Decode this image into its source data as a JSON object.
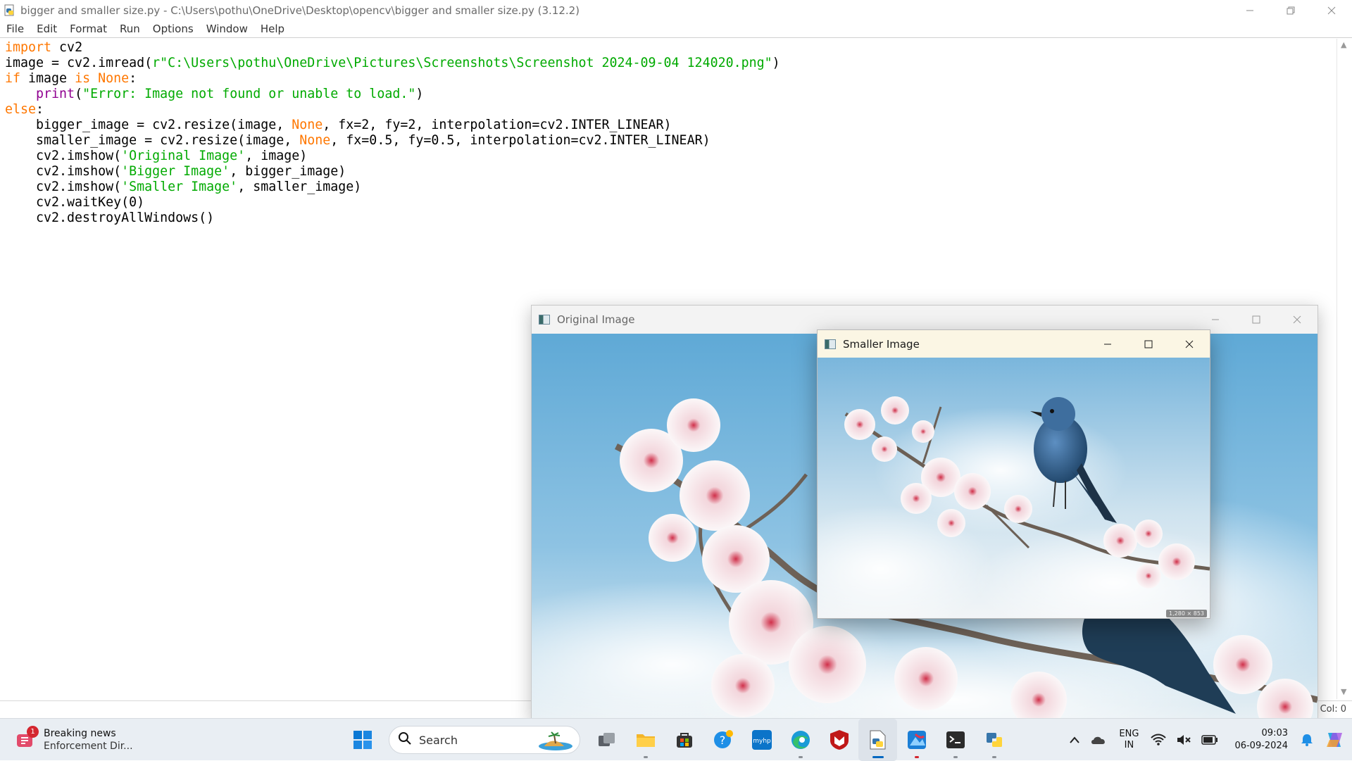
{
  "window": {
    "title": "bigger and smaller size.py - C:\\Users\\pothu\\OneDrive\\Desktop\\opencv\\bigger and smaller size.py (3.12.2)",
    "minimize_icon": "minimize-icon",
    "restore_icon": "restore-icon",
    "close_icon": "close-icon"
  },
  "menu": [
    "File",
    "Edit",
    "Format",
    "Run",
    "Options",
    "Window",
    "Help"
  ],
  "code": {
    "l1_kw": "import",
    "l1_rest": " cv2",
    "l2_a": "image = cv2.imread(",
    "l2_str": "r\"C:\\Users\\pothu\\OneDrive\\Pictures\\Screenshots\\Screenshot 2024-09-04 124020.png\"",
    "l2_b": ")",
    "l3_kw1": "if",
    "l3_a": " image ",
    "l3_kw2": "is",
    "l3_b": " ",
    "l3_kw3": "None",
    "l3_c": ":",
    "l4_indent": "    ",
    "l4_bi": "print",
    "l4_a": "(",
    "l4_str": "\"Error: Image not found or unable to load.\"",
    "l4_b": ")",
    "l5_kw": "else",
    "l5_rest": ":",
    "l6_a": "    bigger_image = cv2.resize(image, ",
    "l6_kw": "None",
    "l6_b": ", fx=2, fy=2, interpolation=cv2.INTER_LINEAR)",
    "l7_a": "    smaller_image = cv2.resize(image, ",
    "l7_kw": "None",
    "l7_b": ", fx=0.5, fy=0.5, interpolation=cv2.INTER_LINEAR)",
    "l8_a": "    cv2.imshow(",
    "l8_str": "'Original Image'",
    "l8_b": ", image)",
    "l9_a": "    cv2.imshow(",
    "l9_str": "'Bigger Image'",
    "l9_b": ", bigger_image)",
    "l10_a": "    cv2.imshow(",
    "l10_str": "'Smaller Image'",
    "l10_b": ", smaller_image)",
    "l11": "    cv2.waitKey(0)",
    "l12": "    cv2.destroyAllWindows()"
  },
  "status": {
    "col": "Col: 0"
  },
  "original_window": {
    "title": "Original Image"
  },
  "smaller_window": {
    "title": "Smaller Image",
    "size_badge": "1,280 × 853"
  },
  "taskbar": {
    "news": {
      "badge": "1",
      "line1": "Breaking news",
      "line2": "Enforcement Dir..."
    },
    "search_label": "Search",
    "apps": [
      "start-icon",
      "search",
      "task-view-icon",
      "file-explorer-icon",
      "microsoft-store-icon",
      "help-icon",
      "myhp-icon",
      "edge-icon",
      "mcafee-icon",
      "idle-editor-icon",
      "photos-icon",
      "terminal-icon",
      "python-icon"
    ],
    "myhp_label": "myhp",
    "tray": {
      "lang1": "ENG",
      "lang2": "IN",
      "time": "09:03",
      "date": "06-09-2024"
    }
  },
  "colors": {
    "keyword": "#ff7700",
    "string": "#00aa00",
    "builtin": "#900090",
    "accent": "#0067c0"
  }
}
